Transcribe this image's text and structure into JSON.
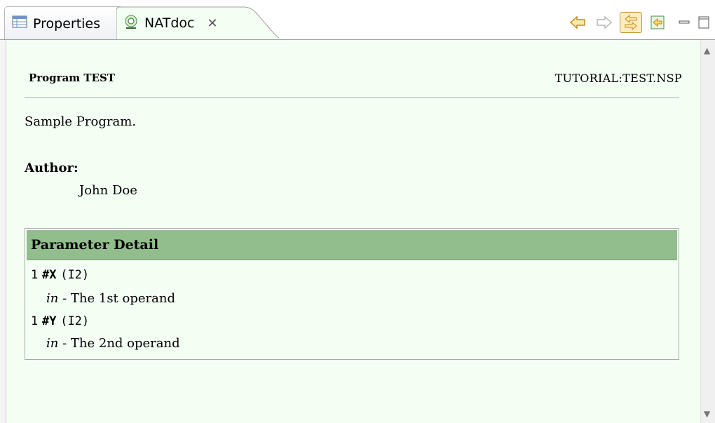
{
  "tabs": [
    {
      "label": "Properties",
      "icon": "table-icon"
    },
    {
      "label": "NATdoc",
      "icon": "natdoc-icon",
      "close_icon": "close-icon"
    }
  ],
  "toolbar": [
    "back-arrow-icon",
    "forward-arrow-icon",
    "link-with-editor-icon",
    "open-source-icon"
  ],
  "window_controls": [
    "minimize-icon",
    "maximize-icon"
  ],
  "doc": {
    "program_title": "Program TEST",
    "program_path": "TUTORIAL:TEST.NSP",
    "description": "Sample Program.",
    "author_label": "Author:",
    "author_name": "John Doe",
    "param_heading": "Parameter Detail",
    "params": [
      {
        "level": "1",
        "name": "#X",
        "type": "(I2)",
        "direction": "in",
        "text": "- The 1st operand"
      },
      {
        "level": "1",
        "name": "#Y",
        "type": "(I2)",
        "direction": "in",
        "text": "- The 2nd operand"
      }
    ]
  },
  "colors": {
    "content_bg": "#f4fff4",
    "param_header_bg": "#92be8e",
    "active_toolbar_bg": "#fbecc2"
  }
}
